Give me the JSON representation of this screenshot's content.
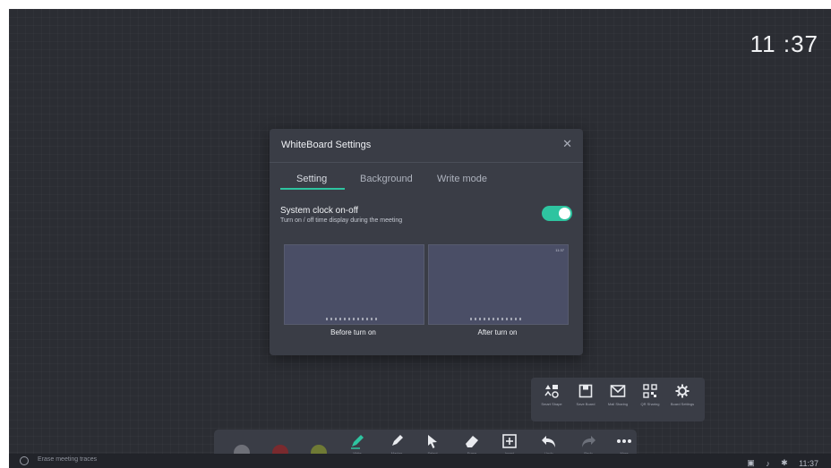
{
  "clock": {
    "time": "11 :37"
  },
  "dialog": {
    "title": "WhiteBoard Settings",
    "close_glyph": "✕",
    "tabs": [
      {
        "label": "Setting",
        "active": true
      },
      {
        "label": "Background",
        "active": false
      },
      {
        "label": "Write mode",
        "active": false
      }
    ],
    "option": {
      "title": "System clock on-off",
      "description": "Turn on / off time display during the meeting",
      "toggle_on": true
    },
    "previews": [
      {
        "label": "Before turn on"
      },
      {
        "label": "After turn on",
        "mini_clock": "11:37"
      }
    ]
  },
  "more_popup": {
    "items": [
      {
        "label": "Smart Shape",
        "icon": "smart-shape-icon"
      },
      {
        "label": "Save Board",
        "icon": "save-icon"
      },
      {
        "label": "Mail Sharing",
        "icon": "mail-icon"
      },
      {
        "label": "QR Sharing",
        "icon": "qr-code-icon"
      },
      {
        "label": "Board Settings",
        "icon": "gear-icon"
      }
    ]
  },
  "toolbar": {
    "colors": [
      "#6e7078",
      "#7a2a2e",
      "#6f7a35"
    ],
    "tools": [
      {
        "label": "Write",
        "icon": "pen-icon"
      },
      {
        "label": "Marker",
        "icon": "marker-icon"
      },
      {
        "label": "Select",
        "icon": "pointer-icon"
      },
      {
        "label": "Erase",
        "icon": "eraser-icon"
      },
      {
        "label": "Insert",
        "icon": "insert-icon"
      },
      {
        "label": "Undo",
        "icon": "undo-icon"
      },
      {
        "label": "Redo",
        "icon": "redo-icon"
      },
      {
        "label": "More",
        "icon": "more-icon"
      }
    ]
  },
  "statusbar": {
    "erase_text": "Erase meeting traces",
    "time": "11:37"
  },
  "colors": {
    "accent": "#2ec4a0",
    "board": "#2b2d33",
    "panel": "#3a3d46"
  }
}
